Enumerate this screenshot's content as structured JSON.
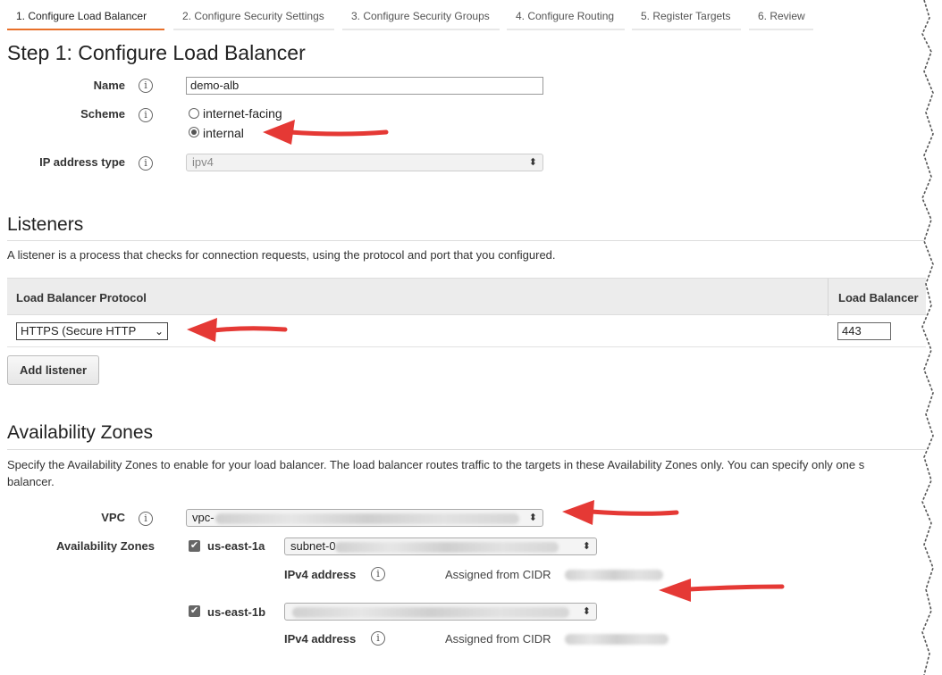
{
  "wizard": {
    "tabs": [
      {
        "label": "1. Configure Load Balancer"
      },
      {
        "label": "2. Configure Security Settings"
      },
      {
        "label": "3. Configure Security Groups"
      },
      {
        "label": "4. Configure Routing"
      },
      {
        "label": "5. Register Targets"
      },
      {
        "label": "6. Review"
      }
    ],
    "active_index": 0
  },
  "page_title": "Step 1: Configure Load Balancer",
  "basic": {
    "name_label": "Name",
    "name_value": "demo-alb",
    "scheme_label": "Scheme",
    "scheme_options": [
      "internet-facing",
      "internal"
    ],
    "scheme_selected": "internal",
    "ip_type_label": "IP address type",
    "ip_type_value": "ipv4"
  },
  "listeners": {
    "heading": "Listeners",
    "description": "A listener is a process that checks for connection requests, using the protocol and port that you configured.",
    "columns": [
      "Load Balancer Protocol",
      "Load Balancer"
    ],
    "rows": [
      {
        "protocol": "HTTPS (Secure HTTP",
        "port": "443"
      }
    ],
    "add_button": "Add listener"
  },
  "availability_zones": {
    "heading": "Availability Zones",
    "description_line1": "Specify the Availability Zones to enable for your load balancer. The load balancer routes traffic to the targets in these Availability Zones only. You can specify only one s",
    "description_line2": "balancer.",
    "vpc_label": "VPC",
    "vpc_value": "vpc-",
    "zones_label": "Availability Zones",
    "zones": [
      {
        "name": "us-east-1a",
        "checked": true,
        "subnet_value": "subnet-0",
        "ipv4_label": "IPv4 address",
        "ipv4_value": "Assigned from CIDR"
      },
      {
        "name": "us-east-1b",
        "checked": true,
        "subnet_value": "",
        "ipv4_label": "IPv4 address",
        "ipv4_value": "Assigned from CIDR"
      }
    ]
  },
  "icons": {
    "info": "i",
    "check": "✔",
    "caret_down": "⌄",
    "select_caret": "⬍"
  },
  "colors": {
    "accent": "#e8702a",
    "arrow": "#e53935"
  }
}
